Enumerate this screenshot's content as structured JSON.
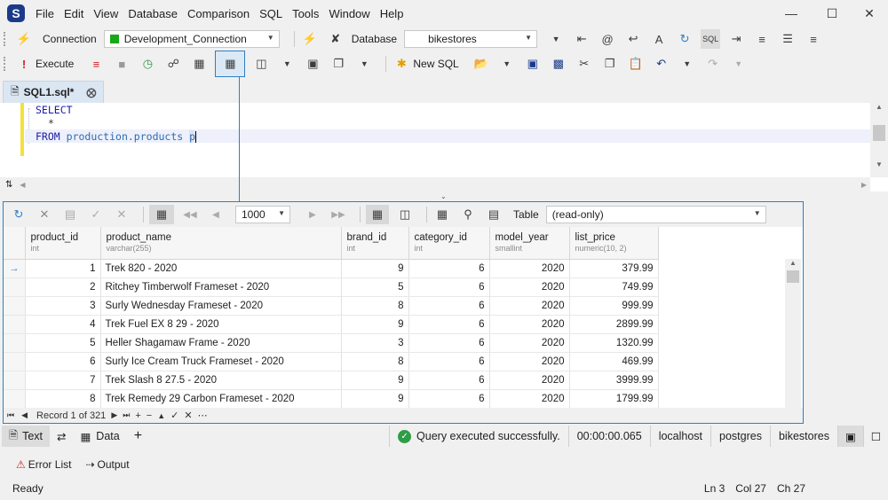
{
  "app": {
    "logo_letter": "S"
  },
  "menu": [
    "File",
    "Edit",
    "View",
    "Database",
    "Comparison",
    "SQL",
    "Tools",
    "Window",
    "Help"
  ],
  "toolbar1": {
    "connection_label": "Connection",
    "connection_value": "Development_Connection",
    "database_label": "Database",
    "database_value": "bikestores"
  },
  "toolbar2": {
    "execute_label": "Execute",
    "new_sql_label": "New SQL"
  },
  "doc_tab": {
    "title": "SQL1.sql*"
  },
  "editor": {
    "line1": "SELECT",
    "line2": "*",
    "line3_kw": "FROM",
    "line3_table": "production.products",
    "line3_alias": "p"
  },
  "grid_toolbar": {
    "page_size": "1000",
    "view_label": "Table",
    "view_value": "(read-only)"
  },
  "columns": [
    {
      "name": "product_id",
      "type": "int"
    },
    {
      "name": "product_name",
      "type": "varchar(255)"
    },
    {
      "name": "brand_id",
      "type": "int"
    },
    {
      "name": "category_id",
      "type": "int"
    },
    {
      "name": "model_year",
      "type": "smallint"
    },
    {
      "name": "list_price",
      "type": "numeric(10, 2)"
    }
  ],
  "rows": [
    [
      "1",
      "Trek 820 - 2020",
      "9",
      "6",
      "2020",
      "379.99"
    ],
    [
      "2",
      "Ritchey Timberwolf Frameset - 2020",
      "5",
      "6",
      "2020",
      "749.99"
    ],
    [
      "3",
      "Surly Wednesday Frameset - 2020",
      "8",
      "6",
      "2020",
      "999.99"
    ],
    [
      "4",
      "Trek Fuel EX 8 29 - 2020",
      "9",
      "6",
      "2020",
      "2899.99"
    ],
    [
      "5",
      "Heller Shagamaw Frame - 2020",
      "3",
      "6",
      "2020",
      "1320.99"
    ],
    [
      "6",
      "Surly Ice Cream Truck Frameset - 2020",
      "8",
      "6",
      "2020",
      "469.99"
    ],
    [
      "7",
      "Trek Slash 8 27.5 - 2020",
      "9",
      "6",
      "2020",
      "3999.99"
    ],
    [
      "8",
      "Trek Remedy 29 Carbon Frameset - 2020",
      "9",
      "6",
      "2020",
      "1799.99"
    ]
  ],
  "navigator": {
    "record_text": "Record 1 of 321"
  },
  "bottom_tabs": {
    "text": "Text",
    "data": "Data"
  },
  "status": {
    "message": "Query executed successfully.",
    "duration": "00:00:00.065",
    "host": "localhost",
    "user": "postgres",
    "database": "bikestores"
  },
  "output_tabs": {
    "error_list": "Error List",
    "output": "Output"
  },
  "statusbar": {
    "ready": "Ready",
    "ln": "Ln 3",
    "col": "Col 27",
    "ch": "Ch 27"
  },
  "colors": {
    "accent": "#2f7fc1",
    "success": "#2e9d47",
    "connection": "#18a818"
  }
}
